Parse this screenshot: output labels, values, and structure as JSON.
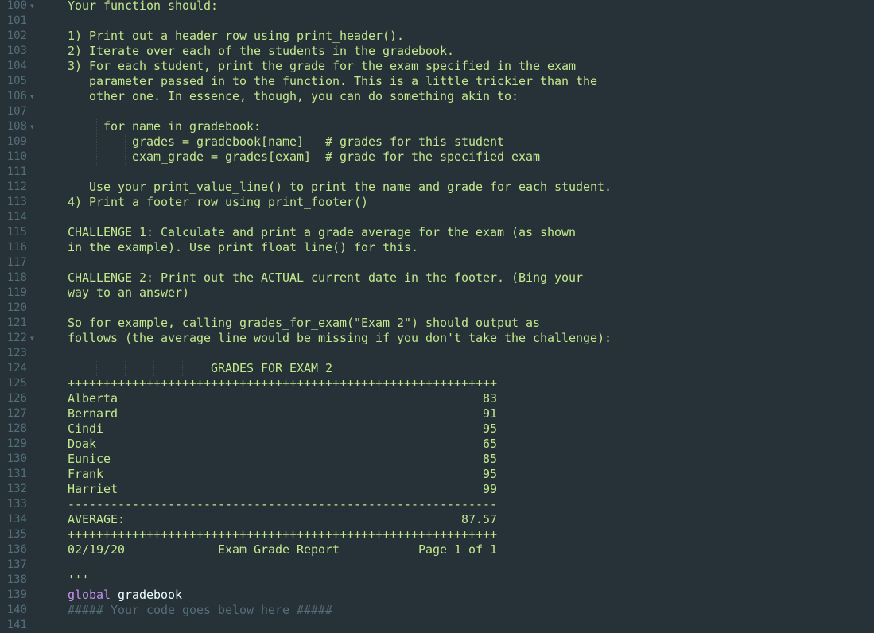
{
  "editor": {
    "theme_colors": {
      "background": "#263238",
      "string": "#C3E88D",
      "line_number": "#546E7A",
      "keyword": "#C792EA",
      "identifier": "#EEFFFF",
      "comment": "#546E7A"
    },
    "lines": [
      {
        "num": "100",
        "fold": true,
        "text": "Your function should:",
        "type": "string"
      },
      {
        "num": "101",
        "fold": false,
        "text": "",
        "type": "string"
      },
      {
        "num": "102",
        "fold": false,
        "text": "1) Print out a header row using print_header().",
        "type": "string"
      },
      {
        "num": "103",
        "fold": false,
        "text": "2) Iterate over each of the students in the gradebook.",
        "type": "string"
      },
      {
        "num": "104",
        "fold": false,
        "text": "3) For each student, print the grade for the exam specified in the exam",
        "type": "string"
      },
      {
        "num": "105",
        "fold": false,
        "text": "   parameter passed in to the function. This is a little trickier than the",
        "type": "string"
      },
      {
        "num": "106",
        "fold": true,
        "text": "   other one. In essence, though, you can do something akin to:",
        "type": "string"
      },
      {
        "num": "107",
        "fold": false,
        "text": "",
        "type": "string"
      },
      {
        "num": "108",
        "fold": true,
        "text": "     for name in gradebook:",
        "type": "string"
      },
      {
        "num": "109",
        "fold": false,
        "text": "         grades = gradebook[name]   # grades for this student",
        "type": "string"
      },
      {
        "num": "110",
        "fold": false,
        "text": "         exam_grade = grades[exam]  # grade for the specified exam",
        "type": "string"
      },
      {
        "num": "111",
        "fold": false,
        "text": "",
        "type": "string"
      },
      {
        "num": "112",
        "fold": false,
        "text": "   Use your print_value_line() to print the name and grade for each student.",
        "type": "string"
      },
      {
        "num": "113",
        "fold": false,
        "text": "4) Print a footer row using print_footer()",
        "type": "string"
      },
      {
        "num": "114",
        "fold": false,
        "text": "",
        "type": "string"
      },
      {
        "num": "115",
        "fold": false,
        "text": "CHALLENGE 1: Calculate and print a grade average for the exam (as shown",
        "type": "string"
      },
      {
        "num": "116",
        "fold": false,
        "text": "in the example). Use print_float_line() for this.",
        "type": "string"
      },
      {
        "num": "117",
        "fold": false,
        "text": "",
        "type": "string"
      },
      {
        "num": "118",
        "fold": false,
        "text": "CHALLENGE 2: Print out the ACTUAL current date in the footer. (Bing your",
        "type": "string"
      },
      {
        "num": "119",
        "fold": false,
        "text": "way to an answer)",
        "type": "string"
      },
      {
        "num": "120",
        "fold": false,
        "text": "",
        "type": "string"
      },
      {
        "num": "121",
        "fold": false,
        "text": "So for example, calling grades_for_exam(\"Exam 2\") should output as",
        "type": "string"
      },
      {
        "num": "122",
        "fold": true,
        "text": "follows (the average line would be missing if you don't take the challenge):",
        "type": "string"
      },
      {
        "num": "123",
        "fold": false,
        "text": "",
        "type": "string"
      },
      {
        "num": "124",
        "fold": false,
        "text": "                    GRADES FOR EXAM 2",
        "type": "string"
      },
      {
        "num": "125",
        "fold": false,
        "text": "++++++++++++++++++++++++++++++++++++++++++++++++++++++++++++",
        "type": "string"
      },
      {
        "num": "126",
        "fold": false,
        "text": "Alberta                                                   83",
        "type": "string"
      },
      {
        "num": "127",
        "fold": false,
        "text": "Bernard                                                   91",
        "type": "string"
      },
      {
        "num": "128",
        "fold": false,
        "text": "Cindi                                                     95",
        "type": "string"
      },
      {
        "num": "129",
        "fold": false,
        "text": "Doak                                                      65",
        "type": "string"
      },
      {
        "num": "130",
        "fold": false,
        "text": "Eunice                                                    85",
        "type": "string"
      },
      {
        "num": "131",
        "fold": false,
        "text": "Frank                                                     95",
        "type": "string"
      },
      {
        "num": "132",
        "fold": false,
        "text": "Harriet                                                   99",
        "type": "string"
      },
      {
        "num": "133",
        "fold": false,
        "text": "------------------------------------------------------------",
        "type": "string"
      },
      {
        "num": "134",
        "fold": false,
        "text": "AVERAGE:                                               87.57",
        "type": "string"
      },
      {
        "num": "135",
        "fold": false,
        "text": "++++++++++++++++++++++++++++++++++++++++++++++++++++++++++++",
        "type": "string"
      },
      {
        "num": "136",
        "fold": false,
        "text": "02/19/20             Exam Grade Report           Page 1 of 1",
        "type": "string"
      },
      {
        "num": "137",
        "fold": false,
        "text": "",
        "type": "string"
      },
      {
        "num": "138",
        "fold": false,
        "text": "'''",
        "type": "string"
      },
      {
        "num": "139",
        "fold": false,
        "keyword": "global",
        "identifier": " gradebook",
        "type": "code"
      },
      {
        "num": "140",
        "fold": false,
        "text": "##### Your code goes below here #####",
        "type": "comment"
      },
      {
        "num": "141",
        "fold": false,
        "text": "",
        "type": "string"
      }
    ]
  }
}
